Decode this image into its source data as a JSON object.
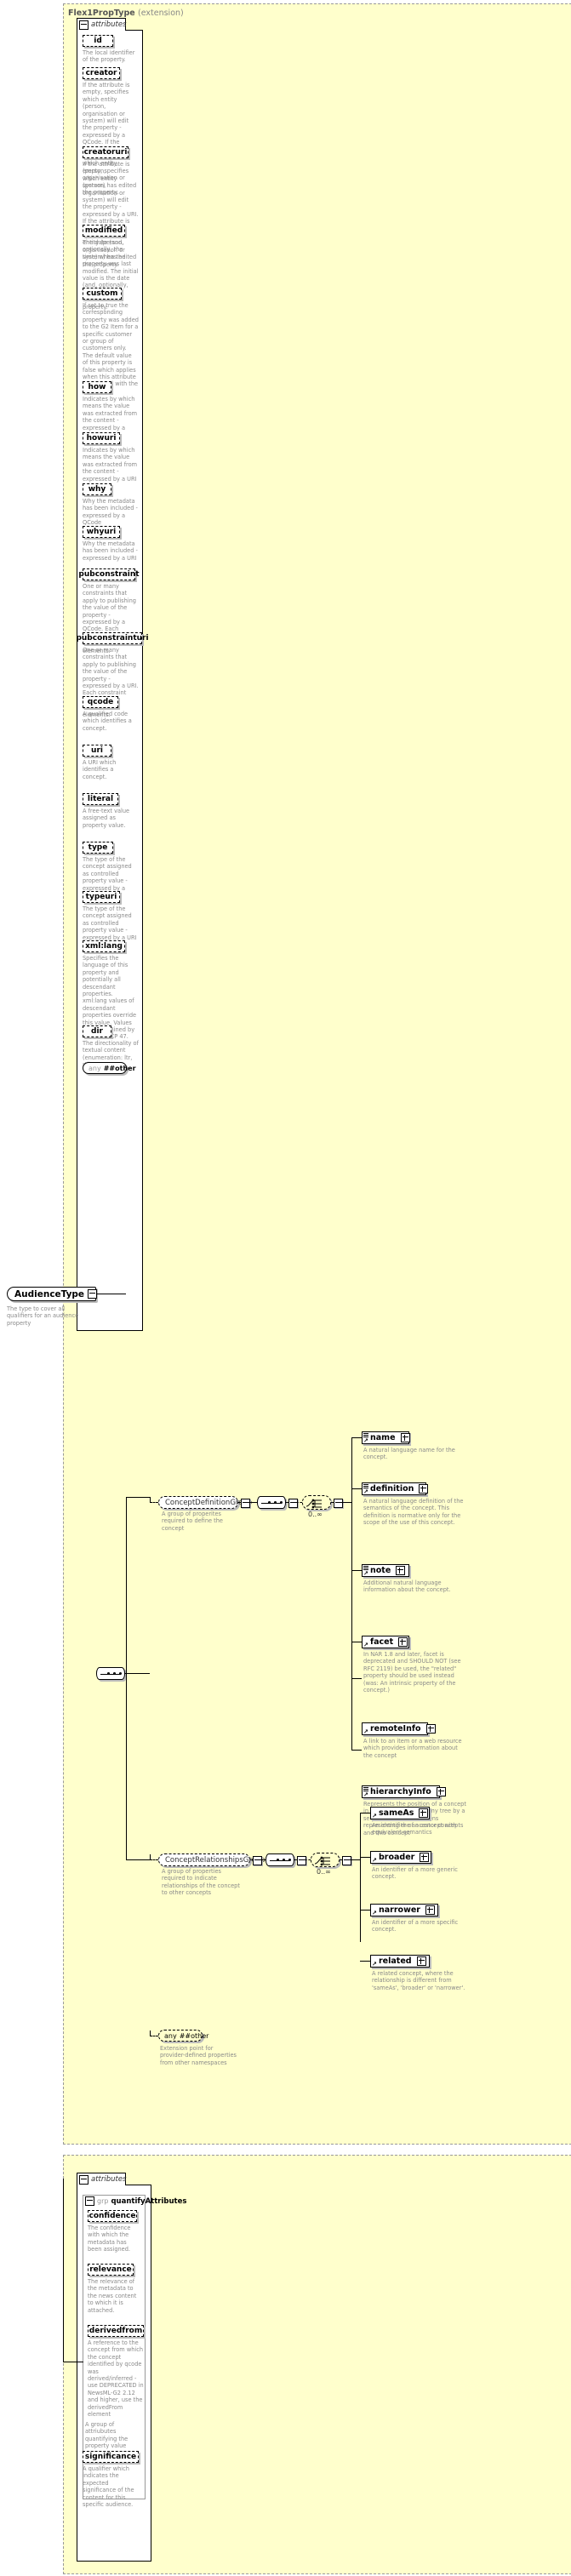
{
  "diagram": {
    "kind": "xsd-schema-documentation",
    "colors": {
      "panel_background": "#ffffcc",
      "box_background": "#ffffff",
      "text": "#000000",
      "description_text": "#8a8a8a",
      "border": "#000000"
    }
  },
  "flexprop": {
    "type_title": "Flex1PropType",
    "type_qualifier": "(extension)",
    "attributes_label": "attributes",
    "any_label_lite": "any",
    "any_label_bold": "##other",
    "attributes": [
      {
        "name": "id",
        "description": "The local identifier of the property."
      },
      {
        "name": "creator",
        "description": "If the attribute is empty, specifies which entity (person, organisation or system) will edit the property - expressed by a QCode. If the attribute is non-empty, specifies which entity (person, organisation or system) has edited the property."
      },
      {
        "name": "creatoruri",
        "description": "If the attribute is empty, specifies which entity (person, organisation or system) will edit the property - expressed by a URI. If the attribute is non-empty, specifies which entity (person, organisation or system) has edited the property."
      },
      {
        "name": "modified",
        "description": "The date (and, optionally, the time) when the property was last modified. The initial value is the date (and, optionally, the time) of creation of the property."
      },
      {
        "name": "custom",
        "description": "If set to true the corresponding property was added to the G2 Item for a specific customer or group of customers only. The default value of this property is false which applies when this attribute is not used with the property."
      },
      {
        "name": "how",
        "description": "Indicates by which means the value was extracted from the content - expressed by a QCode"
      },
      {
        "name": "howuri",
        "description": "Indicates by which means the value was extracted from the content - expressed by a URI"
      },
      {
        "name": "why",
        "description": "Why the metadata has been included - expressed by a QCode"
      },
      {
        "name": "whyuri",
        "description": "Why the metadata has been included - expressed by a URI"
      },
      {
        "name": "pubconstraint",
        "description": "One or many constraints that apply to publishing the value of the property - expressed by a QCode. Each constraint applies to all descendant elements."
      },
      {
        "name": "pubconstrainturi",
        "description": "One or many constraints that apply to publishing the value of the property - expressed by a URI. Each constraint applies to all descendant elements."
      },
      {
        "name": "qcode",
        "description": "A qualified code which identifies a concept."
      },
      {
        "name": "uri",
        "description": "A URI which identifies a concept."
      },
      {
        "name": "literal",
        "description": "A free-text value assigned as property value."
      },
      {
        "name": "type",
        "description": "The type of the concept assigned as controlled property value - expressed by a QCode"
      },
      {
        "name": "typeuri",
        "description": "The type of the concept assigned as controlled property value - expressed by a URI"
      },
      {
        "name": "xml:lang",
        "description": "Specifies the language of this property and potentially all descendant properties. xml:lang values of descendant properties override this value. Values are determined by Internet BCP 47."
      },
      {
        "name": "dir",
        "description": "The directionality of textual content (enumeration: ltr, rtl)"
      }
    ]
  },
  "audience_type": {
    "name": "AudienceType",
    "description": "The type to cover all qualifiers for an audience property"
  },
  "groups": [
    {
      "id": "concept-definition-group",
      "label": "ConceptDefinitionGroup",
      "description": "A group of properites required to define the concept",
      "multiplicity": "0..∞",
      "elements": [
        {
          "name": "name",
          "description": "A natural language name for the concept."
        },
        {
          "name": "definition",
          "description": "A natural language definition of the semantics of the concept. This definition is normative only for the scope of the use of this concept."
        },
        {
          "name": "note",
          "description": "Additional natural language information about the concept."
        },
        {
          "name": "facet",
          "description": "In NAR 1.8 and later, facet is deprecated and SHOULD NOT (see RFC 2119) be used, the \"related\" property should be used instead (was: An intrinsic property of the concept.)"
        },
        {
          "name": "remoteInfo",
          "description": "A link to an item or a web resource which provides information about the concept"
        },
        {
          "name": "hierarchyInfo",
          "description": "Represents the position of a concept in a hierarchical taxonomy tree by a sequence of QCode tokens representing the ancestor concepts and this concept"
        }
      ]
    },
    {
      "id": "concept-relationships-group",
      "label": "ConceptRelationshipsGroup",
      "description": "A group of properties required to indicate relationships of the concept to other concepts",
      "multiplicity": "0..∞",
      "elements": [
        {
          "name": "sameAs",
          "description": "An identifier of a concept with equivalent semantics"
        },
        {
          "name": "broader",
          "description": "An identifier of a more generic concept."
        },
        {
          "name": "narrower",
          "description": "An identifier of a more specific concept."
        },
        {
          "name": "related",
          "description": "A related concept, where the relationship is different from 'sameAs', 'broader' or 'narrower'."
        }
      ]
    }
  ],
  "any_other": {
    "label_lite": "any",
    "label_bold": "##other",
    "description": "Extension point for provider-defined properties from other namespaces"
  },
  "quantify": {
    "attributes_label": "attributes",
    "group_prefix": "grp",
    "group_name": "quantifyAttributes",
    "group_description": "A group of attriubutes quantifying the property value",
    "attributes": [
      {
        "name": "confidence",
        "description": "The confidence with which the metadata has been assigned."
      },
      {
        "name": "relevance",
        "description": "The relevance of the metadata to the news content to which it is attached."
      },
      {
        "name": "derivedfrom",
        "description": "A reference to the concept from which the concept identified by qcode was derived/inferred - use DEPRECATED in NewsML-G2 2.12 and higher, use the derivedFrom element"
      }
    ],
    "trailing_attributes": [
      {
        "name": "significance",
        "description": "A qualifier which indicates the expected significance of the content for this specific audience."
      }
    ]
  }
}
